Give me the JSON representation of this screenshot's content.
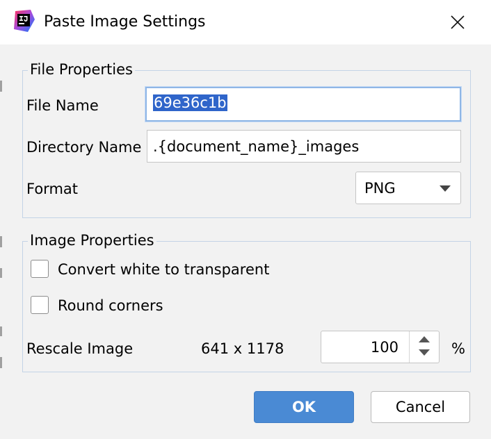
{
  "window": {
    "title": "Paste Image Settings",
    "app_icon": "intellij-icon",
    "close_icon": "close-icon"
  },
  "file_properties": {
    "title": "File Properties",
    "file_name_label": "File Name",
    "file_name_value": "69e36c1b",
    "directory_label": "Directory Name",
    "directory_value": ".{document_name}_images",
    "format_label": "Format",
    "format_value": "PNG"
  },
  "image_properties": {
    "title": "Image Properties",
    "convert_white_label": "Convert white to transparent",
    "convert_white_checked": false,
    "round_corners_label": "Round corners",
    "round_corners_checked": false,
    "rescale_label": "Rescale Image",
    "dimensions": "641 x 1178",
    "scale_value": "100",
    "percent_sign": "%"
  },
  "buttons": {
    "ok_label": "OK",
    "cancel_label": "Cancel"
  },
  "colors": {
    "accent": "#4a8ad4",
    "selection": "#2f65ca",
    "group_border": "#c3d3e6",
    "background": "#f2f2f2"
  }
}
